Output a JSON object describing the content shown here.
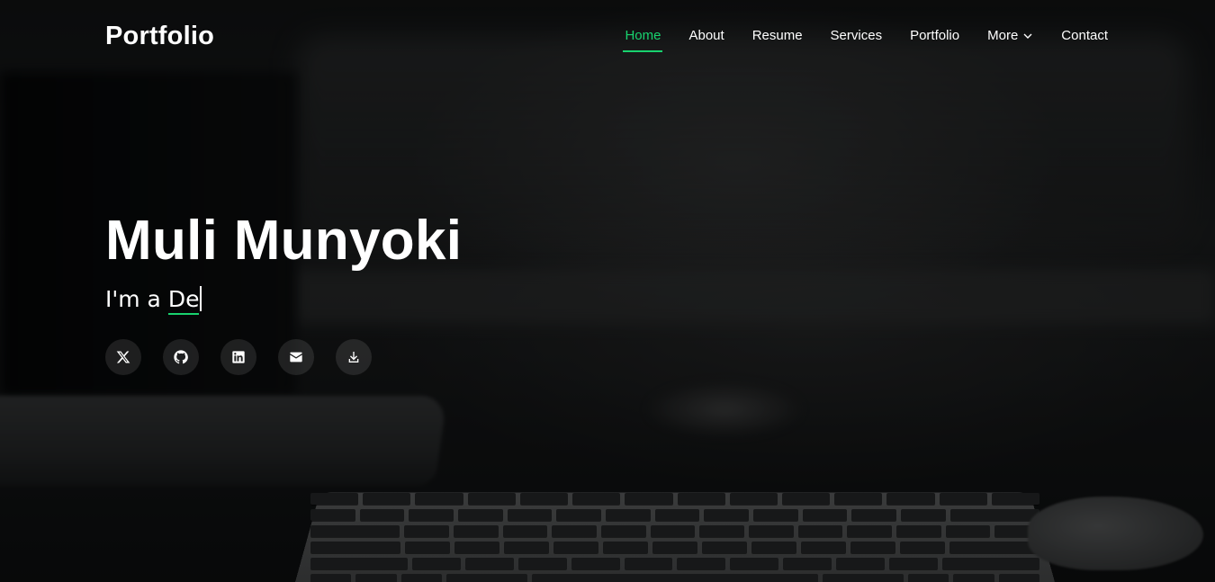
{
  "header": {
    "logo": "Portfolio",
    "nav": [
      {
        "label": "Home",
        "active": true
      },
      {
        "label": "About"
      },
      {
        "label": "Resume"
      },
      {
        "label": "Services"
      },
      {
        "label": "Portfolio"
      },
      {
        "label": "More",
        "has_dropdown": true,
        "icon": "chevron-down-icon"
      },
      {
        "label": "Contact"
      }
    ]
  },
  "hero": {
    "name": "Muli Munyoki",
    "subtitle_prefix": "I'm a",
    "typed_text": "De",
    "social_links": [
      {
        "icon": "x-twitter-icon"
      },
      {
        "icon": "github-icon"
      },
      {
        "icon": "linkedin-icon"
      },
      {
        "icon": "email-icon"
      },
      {
        "icon": "download-icon"
      }
    ]
  },
  "colors": {
    "accent": "#18d26e",
    "text": "#ffffff",
    "social_button_bg": "rgba(255,255,255,0.1)"
  }
}
